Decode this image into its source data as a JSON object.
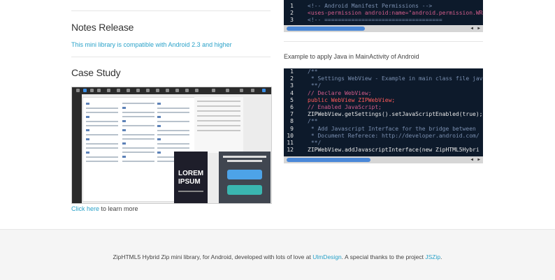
{
  "notes": {
    "heading": "Notes Release",
    "text": "This mini library is compatible with Android 2.3 and higher"
  },
  "case_study": {
    "heading": "Case Study",
    "image_lorem": "LOREM IPSUM",
    "link_text": "Click here",
    "after_link": " to learn more"
  },
  "permissions_code": {
    "lines": [
      {
        "n": "1",
        "text": "<!-- Android Manifest Permissions -->"
      },
      {
        "n": "2",
        "text": "<uses-permission android:name=\"android.permission.WRI"
      },
      {
        "n": "3",
        "text": "<!-- ==================================="
      }
    ]
  },
  "java_example": {
    "intro": "Example to apply Java in MainActivity of Android",
    "lines": [
      {
        "n": "1",
        "text": "/**"
      },
      {
        "n": "2",
        "text": " * Settings WebView - Example in main class file java"
      },
      {
        "n": "3",
        "text": " **/"
      },
      {
        "n": "4",
        "text": "// Declare WebView;"
      },
      {
        "n": "5",
        "text": "public WebView ZIPWebView;"
      },
      {
        "n": "6",
        "text": "// Enabled JavaScript;"
      },
      {
        "n": "7",
        "text": "ZIPWebView.getSettings().setJavaScriptEnabled(true);"
      },
      {
        "n": "8",
        "text": "/**"
      },
      {
        "n": "9",
        "text": " * Add Javascript Interface for the bridge between"
      },
      {
        "n": "10",
        "text": " * Document Referece: http://developer.android.com/"
      },
      {
        "n": "11",
        "text": " **/"
      },
      {
        "n": "12",
        "text": "ZIPWebView.addJavascriptInterface(new ZipHTML5Hybri"
      }
    ]
  },
  "footer": {
    "text_before": "ZipHTML5 Hybrid Zip mini library, for Android, developed with lots of love at ",
    "link1": "UlmDesign",
    "text_middle": ". A special thanks to the project ",
    "link2": "JSZip",
    "text_after": "."
  },
  "colors": {
    "accent": "#2aa2c9",
    "code_bg": "#0d1a2b",
    "footer_bg": "#f5f5f5"
  }
}
